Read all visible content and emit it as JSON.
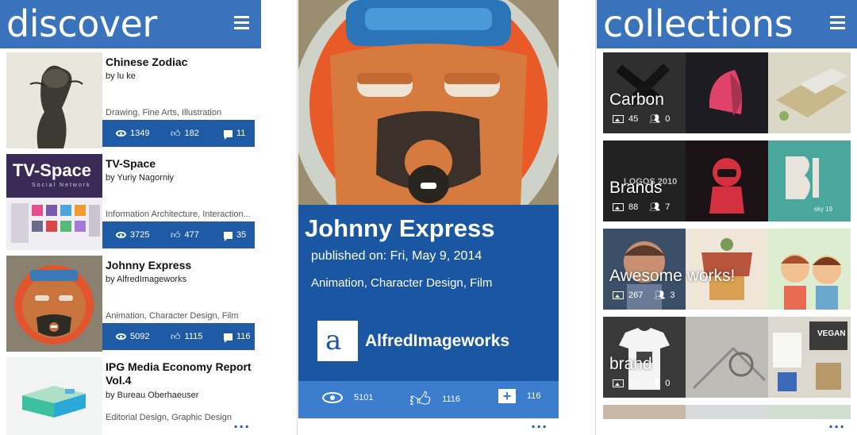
{
  "discover": {
    "title": "discover",
    "items": [
      {
        "title": "Chinese Zodiac",
        "by": "by lu ke",
        "tags": "Drawing, Fine Arts, Illustration",
        "views": "1349",
        "likes": "182",
        "comments": "11"
      },
      {
        "title": "TV-Space",
        "by": "by Yuriy Nagorniy",
        "tags": "Information Architecture, Interaction...",
        "views": "3725",
        "likes": "477",
        "comments": "35",
        "thumb_text": "TV-Space",
        "thumb_subtext": "Social Network"
      },
      {
        "title": "Johnny Express",
        "by": "by AlfredImageworks",
        "tags": "Animation, Character Design, Film",
        "views": "5092",
        "likes": "1115",
        "comments": "116"
      },
      {
        "title": "IPG Media Economy Report Vol.4",
        "by": "by Bureau Oberhaeuser",
        "tags": "Editorial Design, Graphic Design"
      }
    ],
    "more": "..."
  },
  "detail": {
    "title": "Johnny Express",
    "published": "published on: Fri, May 9, 2014",
    "tags": "Animation, Character Design, Film",
    "author_logo": "a",
    "author": "AlfredImageworks",
    "views": "5101",
    "likes": "1116",
    "comments": "116",
    "more": "..."
  },
  "collections": {
    "title": "collections",
    "items": [
      {
        "name": "Carbon",
        "images": "45",
        "followers": "0"
      },
      {
        "name": "Brands",
        "images": "88",
        "followers": "7",
        "thumb_text_1": "LOGOS 2010",
        "thumb_text_2": "sky 19"
      },
      {
        "name": "Awesome works!",
        "images": "267",
        "followers": "3"
      },
      {
        "name": "brand",
        "images": "20",
        "followers": "0",
        "thumb_text": "VEGAN"
      }
    ],
    "more": "..."
  },
  "icons": [
    "hamburger-menu-icon",
    "eye-icon",
    "thumbs-up-icon",
    "comment-icon",
    "image-icon",
    "people-icon"
  ],
  "colors": {
    "header": "#3a73bc",
    "stats_bar": "#1f5aa6",
    "detail_panel": "#1a56a2",
    "detail_stats": "#3c7ccc"
  }
}
